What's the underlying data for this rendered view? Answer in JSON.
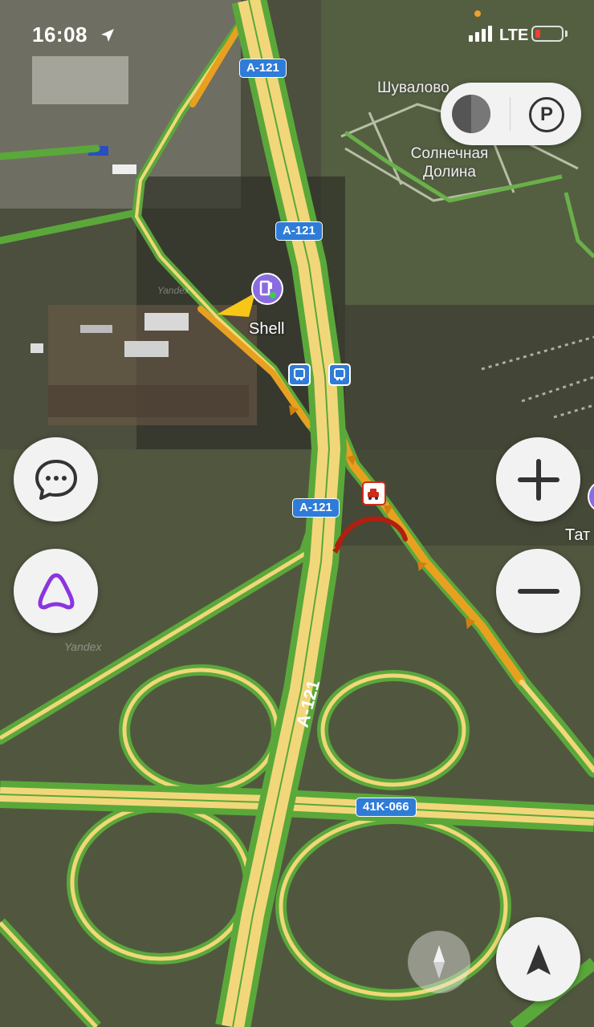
{
  "status_bar": {
    "time": "16:08",
    "network": "LTE",
    "battery_level": 0.1
  },
  "map": {
    "place_labels": [
      {
        "id": "shuvalovo",
        "text": "Шувалово"
      },
      {
        "id": "solnechnaya",
        "text": "Солнечная Долина"
      },
      {
        "id": "tat",
        "text": "Тат"
      }
    ],
    "road_shields": [
      {
        "id": "a121_top",
        "text": "A-121"
      },
      {
        "id": "a121_mid",
        "text": "A-121"
      },
      {
        "id": "a121_lower",
        "text": "A-121"
      },
      {
        "id": "a121_vertical",
        "text": "A-121"
      },
      {
        "id": "41k066",
        "text": "41K-066"
      }
    ],
    "poi": {
      "name": "Shell",
      "icon": "fuel-station-icon"
    },
    "bus_stops": [
      "bus-stop-icon",
      "bus-stop-icon"
    ],
    "incident": "accident-icon",
    "watermark": "Yandex",
    "colors": {
      "traffic_free": "#5aa83a",
      "traffic_slow": "#e8a020",
      "traffic_jam": "#b02010",
      "road_fill": "#f2d77a",
      "shield": "#2f7cd8",
      "poi": "#8b6be0"
    }
  },
  "controls": {
    "layers": {
      "traffic_icon": "traffic-layer-icon",
      "parking_label": "P"
    },
    "chat": "chat-bubble-icon",
    "alice": "alice-assistant-icon",
    "zoom_in": "plus-icon",
    "zoom_out": "minus-icon",
    "compass": "compass-icon",
    "my_location": "navigation-arrow-icon"
  }
}
